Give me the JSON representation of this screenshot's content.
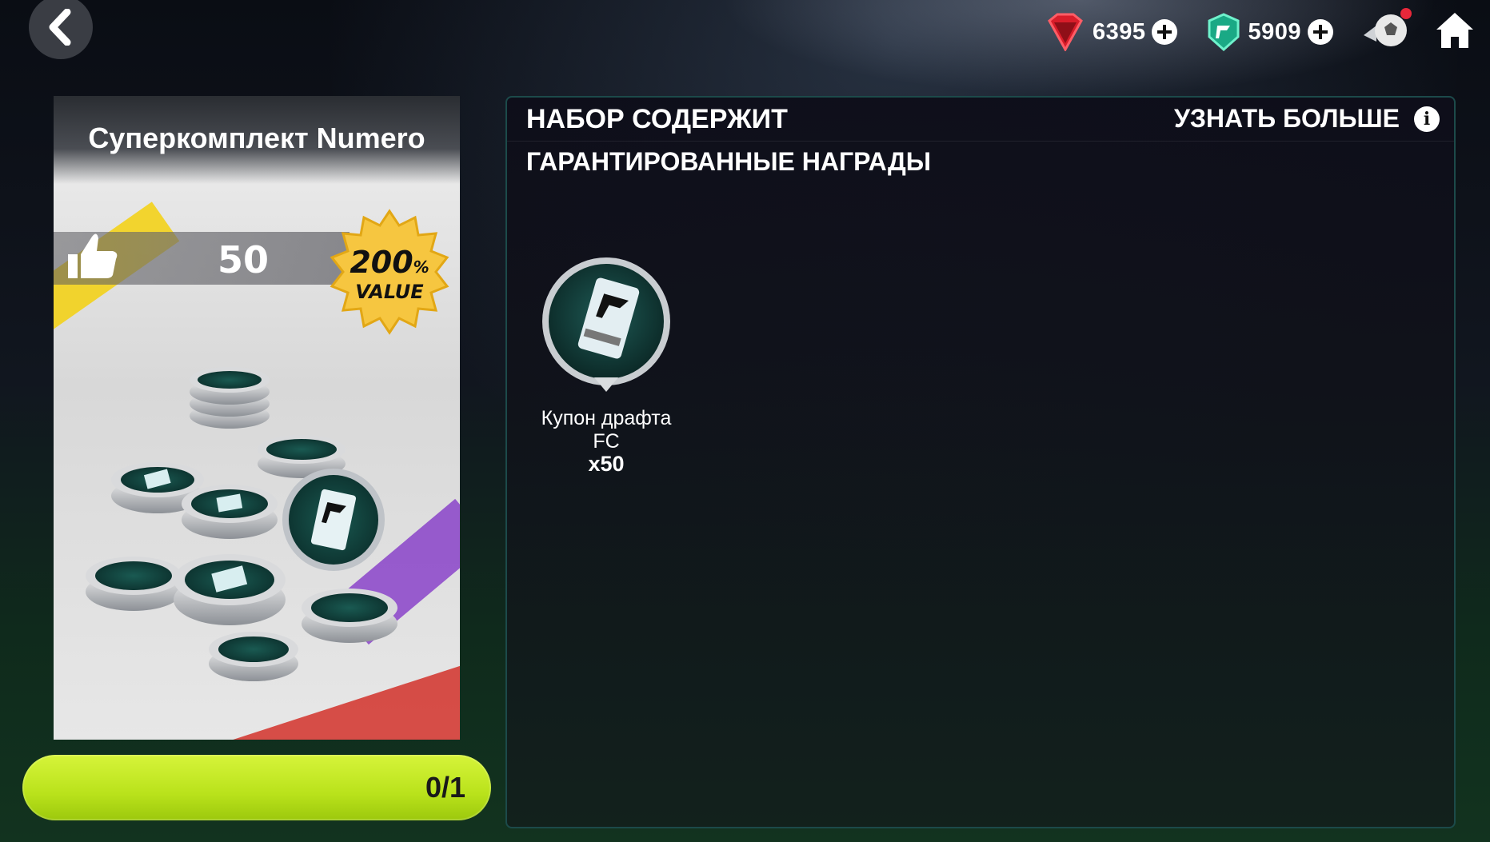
{
  "nav": {
    "back_icon": "chevron-left-icon",
    "home_icon": "home-icon",
    "ball_icon": "soccer-ball-icon"
  },
  "currencies": [
    {
      "icon": "red-gem-icon",
      "amount": "6395",
      "color": "#e0252f"
    },
    {
      "icon": "fc-points-icon",
      "amount": "5909",
      "color": "#1ac49a"
    }
  ],
  "pack": {
    "title": "Суперкомплект Numero",
    "likes": "50",
    "badge_percent": "200",
    "badge_percent_sign": "%",
    "badge_word": "VALUE",
    "progress_text": "0/1",
    "progress_value": 0
  },
  "contents": {
    "title": "НАБОР СОДЕРЖИТ",
    "learn_more": "УЗНАТЬ БОЛЬШЕ",
    "section": "ГАРАНТИРОВАННЫЕ НАГРАДЫ",
    "rewards": [
      {
        "name": "Купон драфта FC",
        "qty": "x50",
        "icon": "draft-coupon-icon"
      }
    ]
  },
  "colors": {
    "accent_green": "#c7ec22",
    "panel_border": "#1c4a4a"
  }
}
